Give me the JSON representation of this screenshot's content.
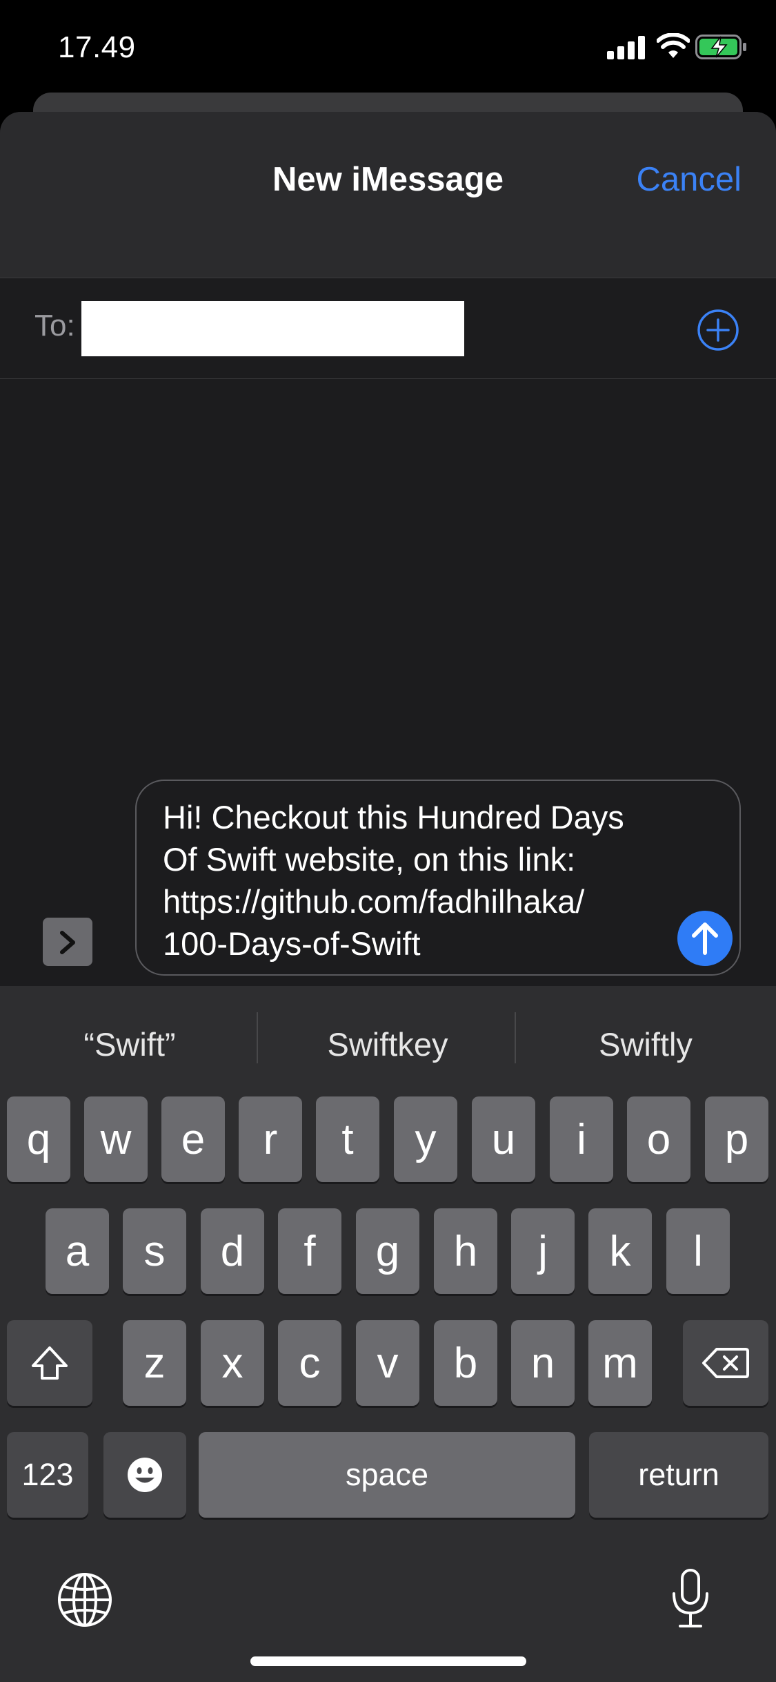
{
  "status_bar": {
    "time": "17.49"
  },
  "header": {
    "title": "New iMessage",
    "cancel_label": "Cancel"
  },
  "to_row": {
    "label": "To:",
    "recipient_value": ""
  },
  "compose": {
    "message_text": "Hi! Checkout this Hundred Days\nOf Swift website, on this link:\nhttps://github.com/fadhilhaka/\n100-Days-of-Swift"
  },
  "keyboard": {
    "suggestions": [
      "“Swift”",
      "Swiftkey",
      "Swiftly"
    ],
    "row1": [
      "q",
      "w",
      "e",
      "r",
      "t",
      "y",
      "u",
      "i",
      "o",
      "p"
    ],
    "row2": [
      "a",
      "s",
      "d",
      "f",
      "g",
      "h",
      "j",
      "k",
      "l"
    ],
    "row3": [
      "z",
      "x",
      "c",
      "v",
      "b",
      "n",
      "m"
    ],
    "numbers_label": "123",
    "space_label": "space",
    "return_label": "return"
  },
  "colors": {
    "accent": "#3b82f6",
    "send_button": "#2f7cf6",
    "background": "#1c1c1e"
  },
  "icons": {
    "add_contact": "plus-circle-icon",
    "apps_toggle": "chevron-right-icon",
    "send": "arrow-up-icon",
    "shift": "shift-icon",
    "delete": "backspace-icon",
    "emoji": "emoji-icon",
    "globe": "globe-icon",
    "microphone": "microphone-icon"
  }
}
